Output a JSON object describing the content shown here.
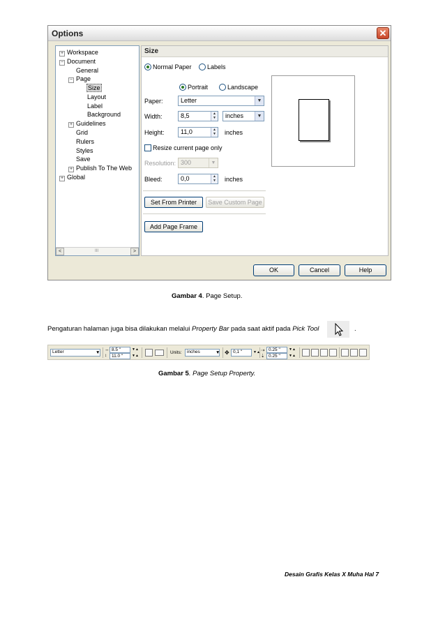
{
  "dialog": {
    "title": "Options",
    "close_glyph": "✕",
    "tree": [
      {
        "label": "Workspace",
        "expander": "+"
      },
      {
        "label": "Document",
        "expander": "−"
      },
      {
        "label": "General",
        "expander": ""
      },
      {
        "label": "Page",
        "expander": "−"
      },
      {
        "label": "Size",
        "expander": ""
      },
      {
        "label": "Layout",
        "expander": ""
      },
      {
        "label": "Label",
        "expander": ""
      },
      {
        "label": "Background",
        "expander": ""
      },
      {
        "label": "Guidelines",
        "expander": "+"
      },
      {
        "label": "Grid",
        "expander": ""
      },
      {
        "label": "Rulers",
        "expander": ""
      },
      {
        "label": "Styles",
        "expander": ""
      },
      {
        "label": "Save",
        "expander": ""
      },
      {
        "label": "Publish To The Web",
        "expander": "+"
      },
      {
        "label": "Global",
        "expander": "+"
      }
    ],
    "tree_selected": "Size",
    "scroll": {
      "left": "<",
      "right": ">",
      "grip": "III"
    },
    "panel": {
      "title": "Size",
      "normal_paper": "Normal Paper",
      "labels": "Labels",
      "portrait": "Portrait",
      "landscape": "Landscape",
      "paper_label": "Paper:",
      "paper_value": "Letter",
      "width_label": "Width:",
      "width_value": "8,5",
      "width_unit": "inches",
      "height_label": "Height:",
      "height_value": "11,0",
      "height_unit": "inches",
      "resize_label": "Resize current page only",
      "resolution_label": "Resolution:",
      "resolution_value": "300",
      "bleed_label": "Bleed:",
      "bleed_value": "0,0",
      "bleed_unit": "inches",
      "set_from_printer": "Set From Printer",
      "save_custom_page": "Save Custom Page",
      "add_page_frame": "Add Page Frame"
    },
    "buttons": {
      "ok": "OK",
      "cancel": "Cancel",
      "help": "Help"
    }
  },
  "caption4": {
    "prefix": "Gambar 4",
    "rest": ". Page Setup."
  },
  "paragraph": {
    "part1": "Pengaturan halaman juga bisa dilakukan melalui ",
    "italic1": "Property Bar",
    "part2": " pada saat aktif pada ",
    "italic2": "Pick Tool",
    "end": "."
  },
  "property_bar": {
    "paper": "Letter",
    "width": "8.5 \"",
    "height": "11.0 \"",
    "units_label": "Units:",
    "units_value": "inches",
    "nudge": "0,1 \"",
    "dup_x": "0.25 \"",
    "dup_y": "0.25 \""
  },
  "caption5": {
    "prefix": "Gambar 5",
    "rest": ". Page Setup Property."
  },
  "footer": "Desain Grafis Kelas X Muha Hal 7"
}
